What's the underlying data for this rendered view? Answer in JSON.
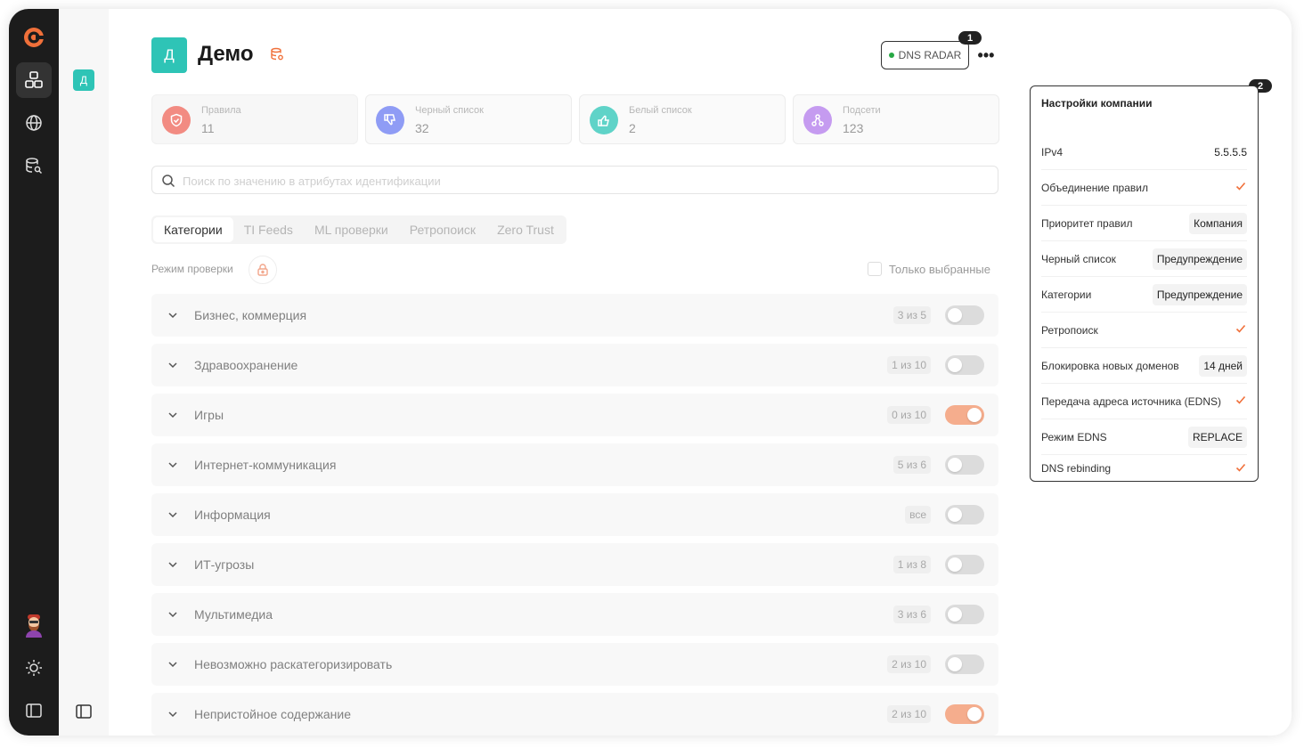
{
  "app": {
    "logo": "app-logo-icon"
  },
  "rail": {
    "items": [
      {
        "icon": "org-icon",
        "active": true
      },
      {
        "icon": "globe-icon"
      },
      {
        "icon": "database-search-icon"
      }
    ],
    "bottom": [
      "user-avatar",
      "theme-icon",
      "panel-toggle-icon"
    ]
  },
  "sub": {
    "avatar_letter": "Д"
  },
  "header": {
    "avatar_letter": "Д",
    "title": "Демо",
    "dns_radar_label": "DNS RADAR",
    "badge1": "1",
    "badge2": "2",
    "more_label": "•••"
  },
  "stats": [
    {
      "label": "Правила",
      "value": "11",
      "color": "#f28b82",
      "icon": "shield-icon"
    },
    {
      "label": "Черный список",
      "value": "32",
      "color": "#8f9cf5",
      "icon": "thumbs-down-icon"
    },
    {
      "label": "Белый список",
      "value": "2",
      "color": "#5fd3c8",
      "icon": "thumbs-up-icon"
    },
    {
      "label": "Подсети",
      "value": "123",
      "color": "#c59bf0",
      "icon": "network-icon"
    }
  ],
  "search": {
    "placeholder": "Поиск по значению в атрибутах идентификации",
    "value": ""
  },
  "tabs": [
    "Категории",
    "TI Feeds",
    "ML проверки",
    "Ретропоиск",
    "Zero Trust"
  ],
  "active_tab": 0,
  "mode": {
    "label": "Режим проверки",
    "only_selected_label": "Только выбранные"
  },
  "categories": [
    {
      "label": "Бизнес, коммерция",
      "count": "3 из 5",
      "on": false
    },
    {
      "label": "Здравоохранение",
      "count": "1 из 10",
      "on": false
    },
    {
      "label": "Игры",
      "count": "0 из 10",
      "on": true
    },
    {
      "label": "Интернет-коммуникация",
      "count": "5 из 6",
      "on": false
    },
    {
      "label": "Информация",
      "count": "все",
      "on": false
    },
    {
      "label": "ИТ-угрозы",
      "count": "1 из 8",
      "on": false
    },
    {
      "label": "Мультимедиа",
      "count": "3 из 6",
      "on": false
    },
    {
      "label": "Невозможно раскатегоризировать",
      "count": "2 из 10",
      "on": false
    },
    {
      "label": "Непристойное содержание",
      "count": "2 из 10",
      "on": true
    }
  ],
  "panel": {
    "title": "Настройки компании",
    "rows": [
      {
        "label": "IPv4",
        "type": "text",
        "value": "5.5.5.5"
      },
      {
        "label": "Объединение правил",
        "type": "check"
      },
      {
        "label": "Приоритет правил",
        "type": "chip",
        "value": "Компания"
      },
      {
        "label": "Черный список",
        "type": "chip",
        "value": "Предупреждение"
      },
      {
        "label": "Категории",
        "type": "chip",
        "value": "Предупреждение"
      },
      {
        "label": "Ретропоиск",
        "type": "check"
      },
      {
        "label": "Блокировка новых доменов",
        "type": "chip",
        "value": "14 дней"
      },
      {
        "label": "Передача адреса источника (EDNS)",
        "type": "check"
      },
      {
        "label": "Режим EDNS",
        "type": "chip",
        "value": "REPLACE"
      },
      {
        "label": "DNS rebinding",
        "type": "check"
      }
    ]
  },
  "colors": {
    "accent": "#f0703a",
    "teal": "#2ec4b6",
    "toggle_on": "#f5ad8d",
    "rail": "#1c1c1c"
  }
}
